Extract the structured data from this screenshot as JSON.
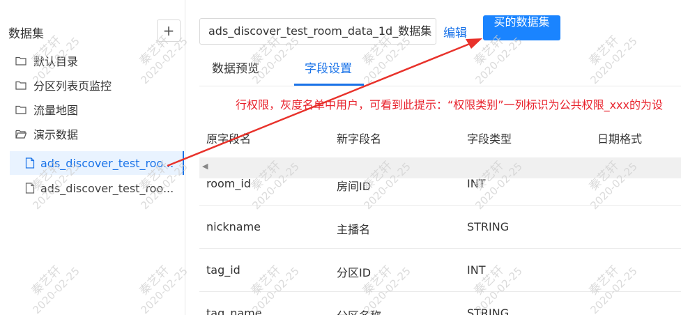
{
  "sidebar": {
    "title": "数据集",
    "add_icon": "+",
    "folders": [
      {
        "label": "默认目录",
        "icon": "folder-icon"
      },
      {
        "label": "分区列表页监控",
        "icon": "folder-icon"
      },
      {
        "label": "流量地图",
        "icon": "folder-icon"
      },
      {
        "label": "演示数据",
        "icon": "folder-open-icon"
      }
    ],
    "files": [
      {
        "label": "ads_discover_test_roo...",
        "active": true
      },
      {
        "label": "ads_discover_test_roo...",
        "active": false
      }
    ]
  },
  "header": {
    "dataset_name": "ads_discover_test_room_data_1d_数据集",
    "edit_label": "编辑",
    "buy_label": "买的数据集"
  },
  "tabs": [
    {
      "label": "数据预览",
      "active": false
    },
    {
      "label": "字段设置",
      "active": true
    }
  ],
  "tip": "行权限，灰度名单中用户，可看到此提示：“权限类别”一列标识为公共权限_xxx的为设",
  "table": {
    "columns": [
      "原字段名",
      "新字段名",
      "字段类型",
      "日期格式"
    ],
    "rows": [
      [
        "room_id",
        "房间ID",
        "INT",
        ""
      ],
      [
        "nickname",
        "主播名",
        "STRING",
        ""
      ],
      [
        "tag_id",
        "分区ID",
        "INT",
        ""
      ],
      [
        "tag_name",
        "分区名称",
        "STRING",
        ""
      ]
    ]
  },
  "watermark": {
    "name": "秦艺轩",
    "date": "2020-02-25"
  },
  "colors": {
    "accent": "#1a73e8",
    "button": "#1a84ff",
    "warning": "#e8212b",
    "arrow": "#e8322b"
  }
}
